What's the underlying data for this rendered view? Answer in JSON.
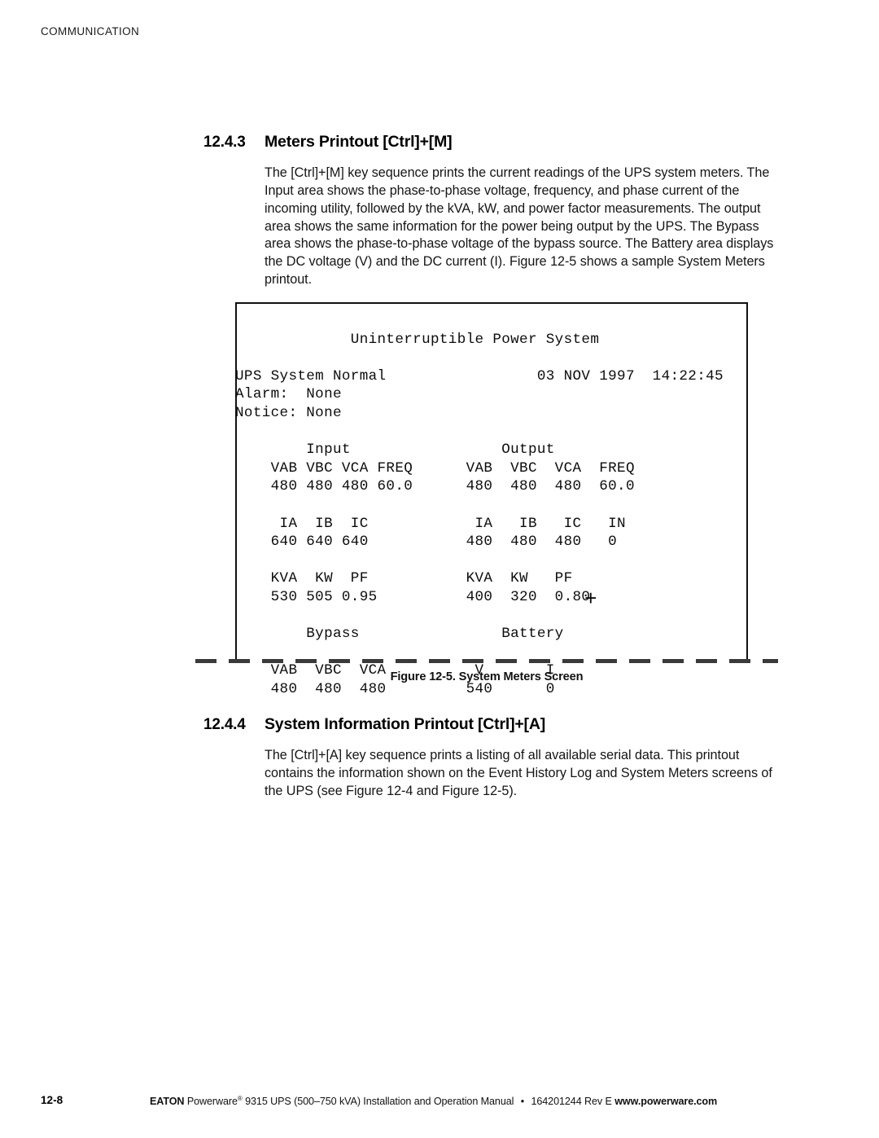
{
  "running_head": "COMMUNICATION",
  "sections": [
    {
      "number": "12.4.3",
      "title": "Meters Printout [Ctrl]+[M]",
      "body": "The [Ctrl]+[M] key sequence prints the current readings of the UPS system meters. The Input area shows the phase-to-phase voltage, frequency, and phase current of the incoming utility, followed by the kVA, kW, and power factor measurements. The output area shows the same information for the power being output by the UPS. The Bypass area shows the phase-to-phase voltage of the bypass source. The Battery area displays the DC voltage (V) and the DC current (I). Figure 12-5 shows a sample System Meters printout."
    },
    {
      "number": "12.4.4",
      "title": "System Information Printout [Ctrl]+[A]",
      "body": "The [Ctrl]+[A] key sequence prints a listing of all available serial data. This printout contains the information shown on the Event History Log and System Meters screens of the UPS (see Figure 12-4 and Figure 12-5)."
    }
  ],
  "figure": {
    "caption": "Figure 12-5. System Meters Screen",
    "screen": {
      "title": "Uninterruptible Power System",
      "status": "UPS System Normal",
      "date": "03 NOV 1997",
      "time": "14:22:45",
      "alarm_label": "Alarm:",
      "alarm_value": "None",
      "notice_label": "Notice:",
      "notice_value": "None",
      "input_heading": "Input",
      "output_heading": "Output",
      "bypass_heading": "Bypass",
      "battery_heading": "Battery",
      "battery_polarity": "+",
      "input": {
        "voltage_headers": [
          "VAB",
          "VBC",
          "VCA",
          "FREQ"
        ],
        "voltage_values": [
          "480",
          "480",
          "480",
          "60.0"
        ],
        "current_headers": [
          "IA",
          "IB",
          "IC"
        ],
        "current_values": [
          "640",
          "640",
          "640"
        ],
        "power_headers": [
          "KVA",
          "KW",
          "PF"
        ],
        "power_values": [
          "530",
          "505",
          "0.95"
        ]
      },
      "output": {
        "voltage_headers": [
          "VAB",
          "VBC",
          "VCA",
          "FREQ"
        ],
        "voltage_values": [
          "480",
          "480",
          "480",
          "60.0"
        ],
        "current_headers": [
          "IA",
          "IB",
          "IC",
          "IN"
        ],
        "current_values": [
          "480",
          "480",
          "480",
          "0"
        ],
        "power_headers": [
          "KVA",
          "KW",
          "PF"
        ],
        "power_values": [
          "400",
          "320",
          "0.80"
        ]
      },
      "bypass": {
        "voltage_headers": [
          "VAB",
          "VBC",
          "VCA"
        ],
        "voltage_values": [
          "480",
          "480",
          "480"
        ]
      },
      "battery": {
        "headers": [
          "V",
          "I"
        ],
        "values": [
          "540",
          "0"
        ]
      },
      "lines": [
        "             Uninterruptible Power System",
        "",
        "UPS System Normal                 03 NOV 1997  14:22:45",
        "Alarm:  None",
        "Notice: None",
        "",
        "        Input                 Output",
        "    VAB VBC VCA FREQ      VAB  VBC  VCA  FREQ",
        "    480 480 480 60.0      480  480  480  60.0",
        "",
        "     IA  IB  IC            IA   IB   IC   IN",
        "    640 640 640           480  480  480   0",
        "",
        "    KVA  KW  PF           KVA  KW   PF",
        "    530 505 0.95          400  320  0.80",
        "",
        "        Bypass                Battery",
        "",
        "    VAB  VBC  VCA          V       I",
        "    480  480  480         540      0"
      ]
    }
  },
  "footer": {
    "page": "12-8",
    "brand": "EATON",
    "product": "Powerware",
    "registered": "®",
    "description": "9315 UPS (500–750 kVA) Installation and Operation Manual",
    "separator": "•",
    "doc_number": "164201244 Rev E",
    "website": "www.powerware.com"
  }
}
